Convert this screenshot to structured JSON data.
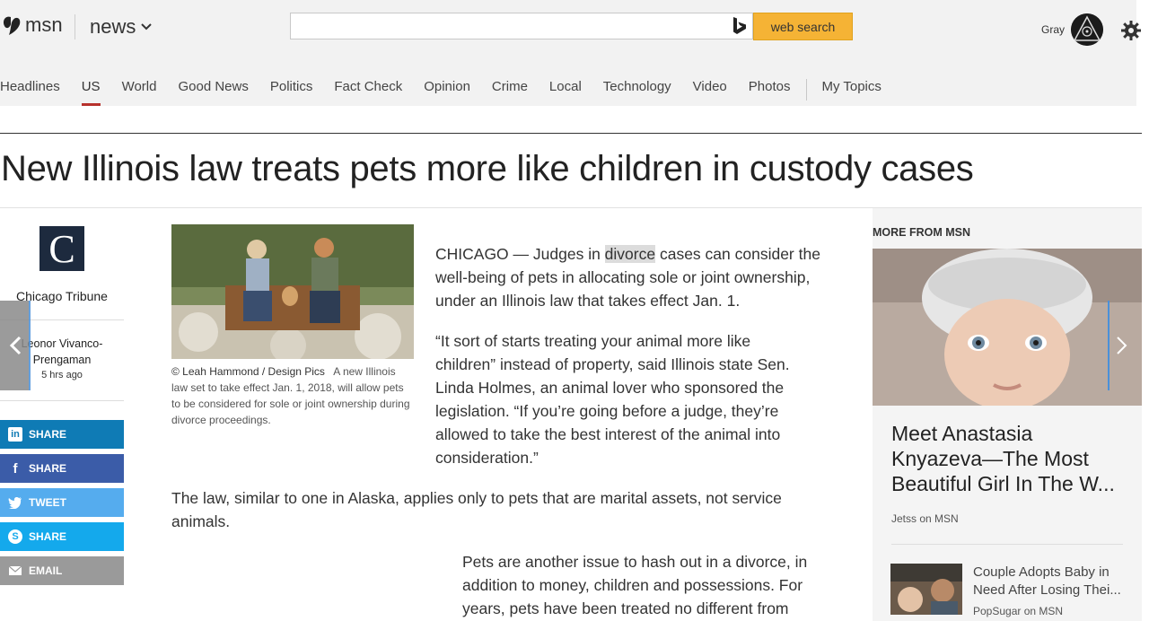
{
  "header": {
    "logo": "msn",
    "section": "news",
    "search": {
      "placeholder": "",
      "button": "web search"
    },
    "user": "Gray"
  },
  "nav": {
    "items": [
      {
        "label": "Headlines"
      },
      {
        "label": "US",
        "active": true
      },
      {
        "label": "World"
      },
      {
        "label": "Good News"
      },
      {
        "label": "Politics"
      },
      {
        "label": "Fact Check"
      },
      {
        "label": "Opinion"
      },
      {
        "label": "Crime"
      },
      {
        "label": "Local"
      },
      {
        "label": "Technology"
      },
      {
        "label": "Video"
      },
      {
        "label": "Photos"
      }
    ],
    "my_topics": "My Topics"
  },
  "article": {
    "headline": "New Illinois law treats pets more like children in custody cases",
    "source": "Chicago Tribune",
    "source_logo": "C",
    "author": "Leonor Vivanco-Prengaman",
    "time": "5 hrs ago",
    "image_credit": "© Leah Hammond / Design Pics",
    "image_caption": "A new Illinois law set to take effect Jan. 1, 2018, will allow pets to be considered for sole or joint ownership during divorce proceedings.",
    "p1_before": "CHICAGO — Judges in ",
    "p1_highlight": "divorce",
    "p1_after": " cases can consider the well-being of pets in allocating sole or joint ownership, under an Illinois law that takes effect Jan. 1.",
    "p2": "“It sort of starts treating your animal more like children” instead of property, said Illinois state Sen. Linda Holmes, an animal lover who sponsored the legislation. “If you’re going before a judge, they’re allowed to take the best interest of the animal into consideration.”",
    "p3": "The law, similar to one in Alaska, applies only to pets that are marital assets, not service animals.",
    "p4": "Pets are another issue to hash out in a divorce, in addition to money, children and possessions. For years, pets have been treated no different from"
  },
  "share": {
    "linkedin": "SHARE",
    "facebook": "SHARE",
    "twitter": "TWEET",
    "skype": "SHARE",
    "email": "EMAIL"
  },
  "more_from_msn": {
    "title": "MORE FROM MSN",
    "featured": {
      "title": "Meet Anastasia Knyazeva—The Most Beautiful Girl In The W...",
      "source": "Jetss on MSN"
    },
    "item": {
      "title": "Couple Adopts Baby in Need After Losing Thei...",
      "source": "PopSugar on MSN"
    }
  },
  "colors": {
    "accent_bar": "#b7312c",
    "search_button": "#f5b335",
    "linkedin": "#0f7bb5",
    "facebook": "#3b5ca8",
    "twitter": "#55acee",
    "skype": "#14a9ec",
    "email": "#9a9a9a"
  }
}
